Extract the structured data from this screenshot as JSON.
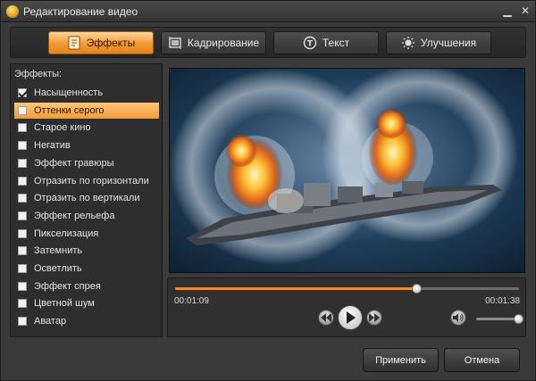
{
  "window": {
    "title": "Редактирование видео",
    "minimize_glyph": "▁",
    "close_glyph": "✕"
  },
  "tabs": [
    {
      "label": "Эффекты",
      "icon": "effects-icon",
      "active": true
    },
    {
      "label": "Кадрирование",
      "icon": "crop-icon",
      "active": false
    },
    {
      "label": "Текст",
      "icon": "text-icon",
      "active": false
    },
    {
      "label": "Улучшения",
      "icon": "brightness-icon",
      "active": false
    }
  ],
  "effects_panel": {
    "title": "Эффекты:",
    "items": [
      {
        "label": "Насыщенность",
        "checked": true,
        "selected": false
      },
      {
        "label": "Оттенки серого",
        "checked": false,
        "selected": true
      },
      {
        "label": "Старое кино",
        "checked": false,
        "selected": false
      },
      {
        "label": "Негатив",
        "checked": false,
        "selected": false
      },
      {
        "label": "Эффект гравюры",
        "checked": false,
        "selected": false
      },
      {
        "label": "Отразить по горизонтали",
        "checked": false,
        "selected": false
      },
      {
        "label": "Отразить по вертикали",
        "checked": false,
        "selected": false
      },
      {
        "label": "Эффект рельефа",
        "checked": false,
        "selected": false
      },
      {
        "label": "Пикселизация",
        "checked": false,
        "selected": false
      },
      {
        "label": "Затемнить",
        "checked": false,
        "selected": false
      },
      {
        "label": "Осветлить",
        "checked": false,
        "selected": false
      },
      {
        "label": "Эффект спрея",
        "checked": false,
        "selected": false
      },
      {
        "label": "Цветной шум",
        "checked": false,
        "selected": false
      },
      {
        "label": "Аватар",
        "checked": false,
        "selected": false
      }
    ]
  },
  "player": {
    "current_time": "00:01:09",
    "total_time": "00:01:38",
    "progress_fraction": 0.7,
    "volume_fraction": 1.0
  },
  "buttons": {
    "apply": "Применить",
    "cancel": "Отмена"
  },
  "colors": {
    "accent": "#f39a34",
    "progress": "#ff8a1c",
    "background": "#3a3a3a"
  }
}
